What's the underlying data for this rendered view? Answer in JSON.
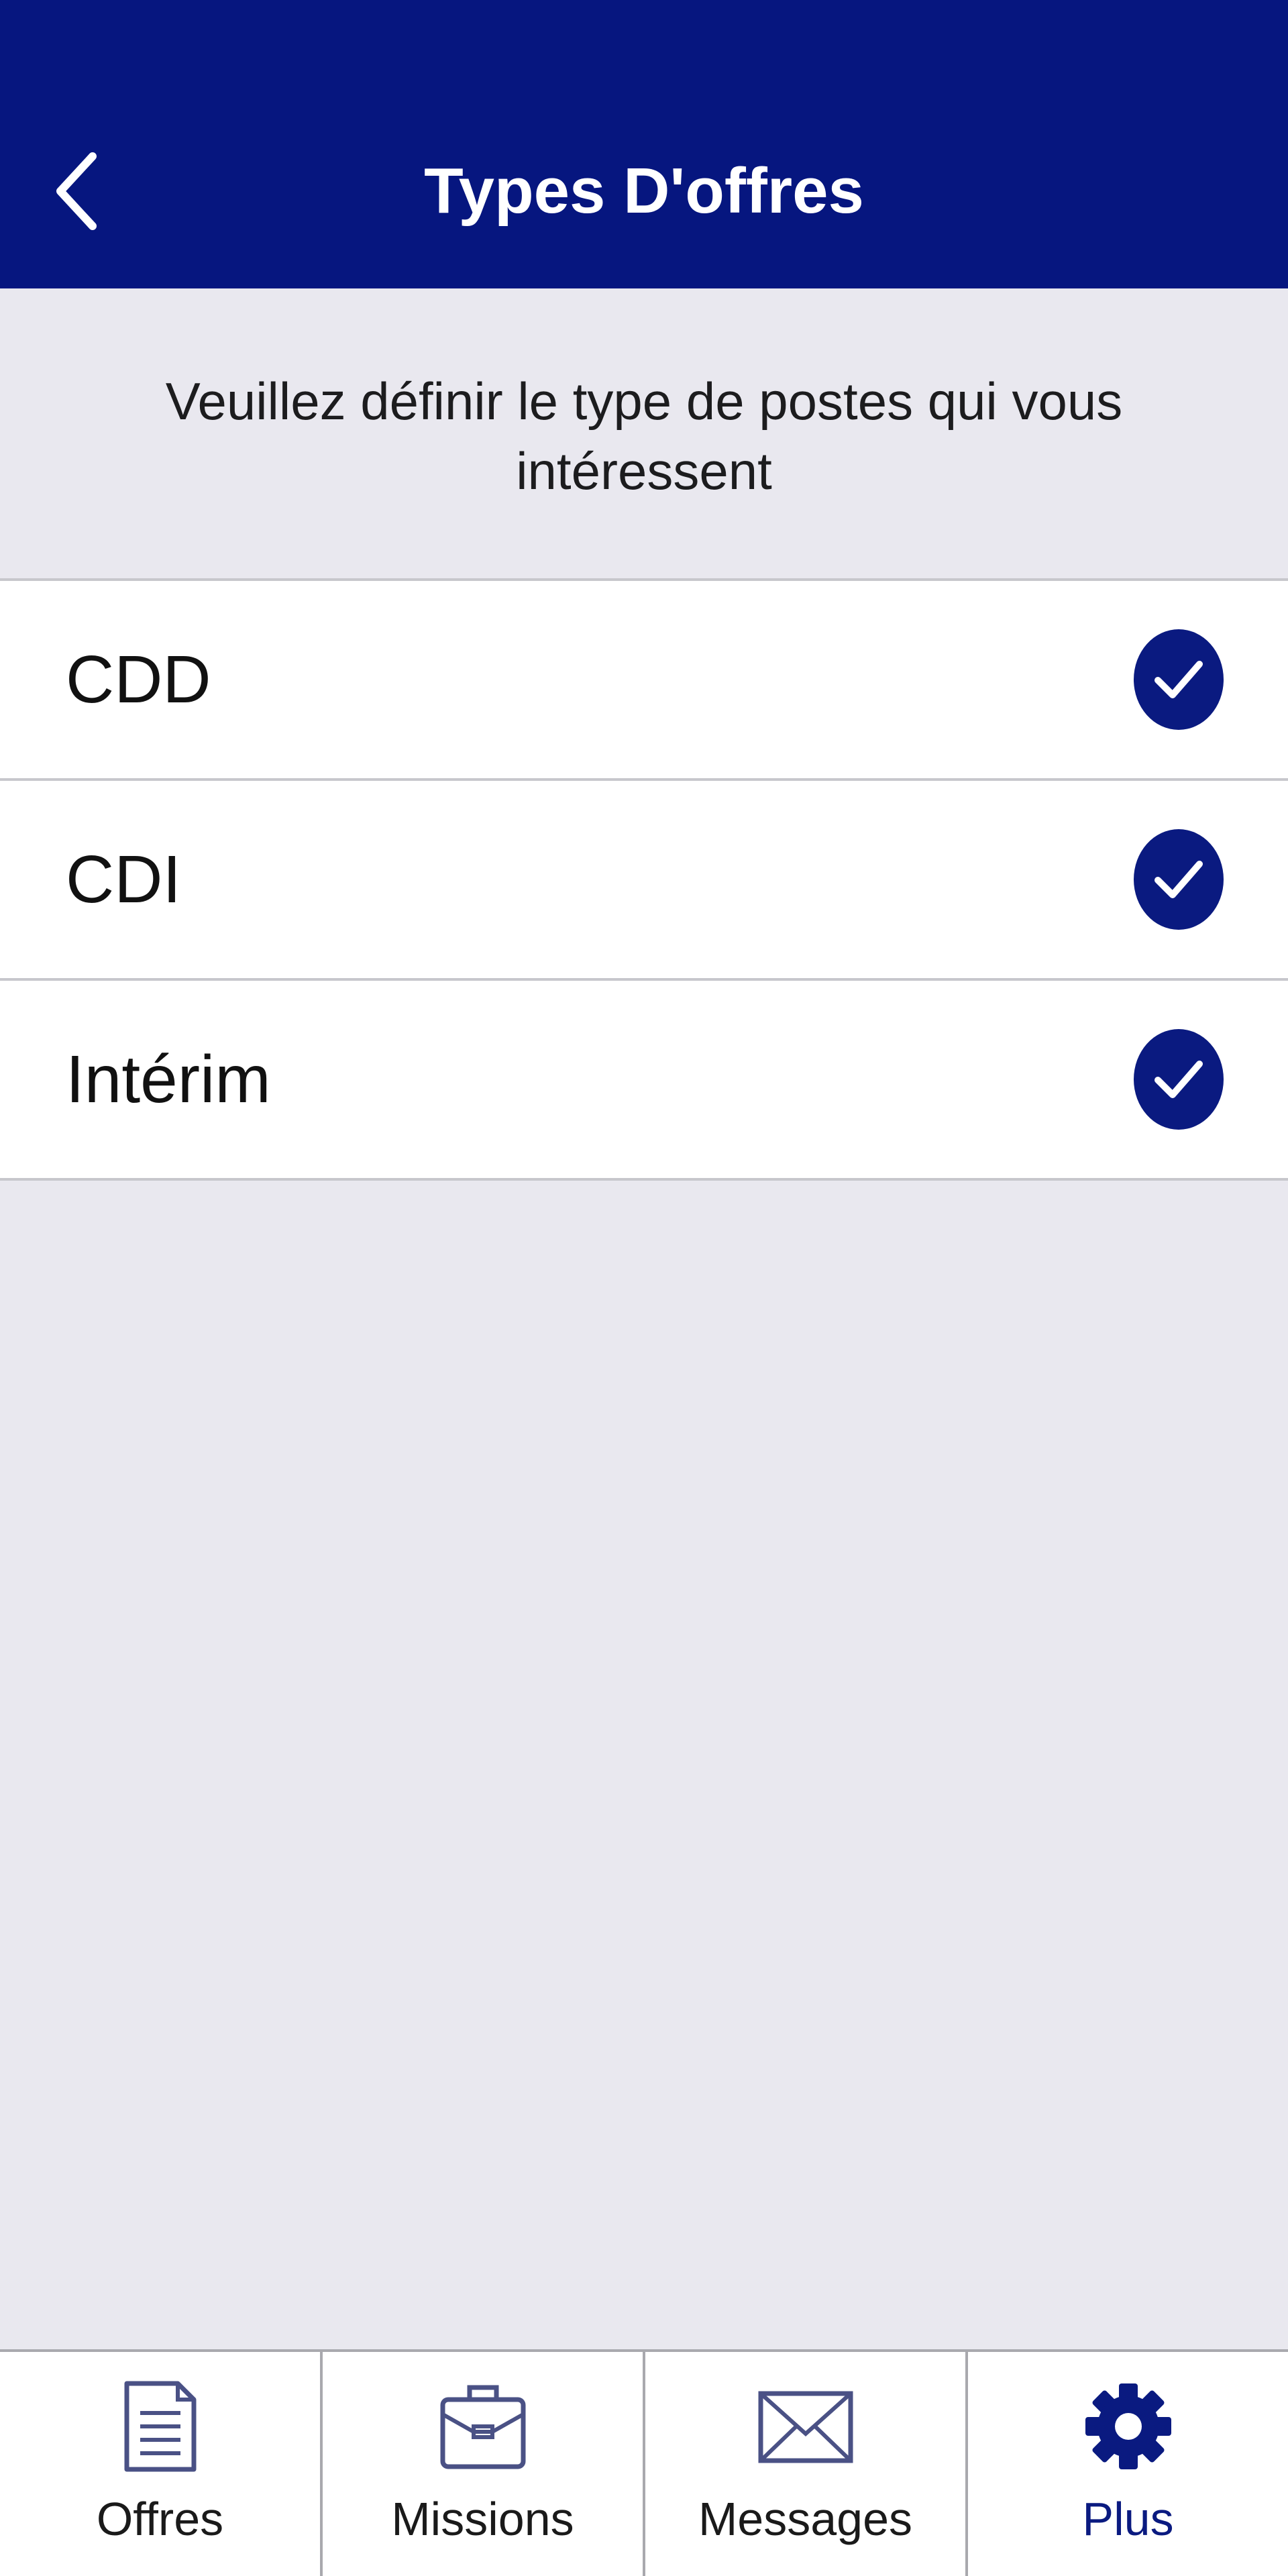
{
  "header": {
    "title": "Types D'offres",
    "back_icon": "chevron-left-icon"
  },
  "info": {
    "text": "Veuillez définir le type de postes qui vous intéressent"
  },
  "options": [
    {
      "label": "CDD",
      "checked": true
    },
    {
      "label": "CDI",
      "checked": true
    },
    {
      "label": "Intérim",
      "checked": true
    }
  ],
  "tabbar": {
    "tabs": [
      {
        "label": "Offres",
        "icon": "document-icon",
        "active": false
      },
      {
        "label": "Missions",
        "icon": "briefcase-icon",
        "active": false
      },
      {
        "label": "Messages",
        "icon": "envelope-icon",
        "active": false
      },
      {
        "label": "Plus",
        "icon": "gear-icon",
        "active": true
      }
    ]
  },
  "colors": {
    "brand": "#06167f",
    "background": "#e9e8ef",
    "separator": "#c7c7cc"
  }
}
